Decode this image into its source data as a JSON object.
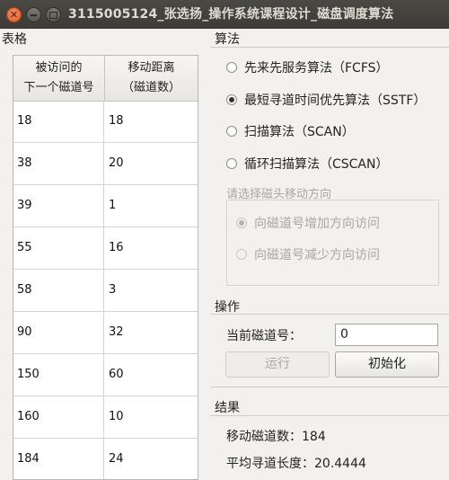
{
  "window": {
    "title": "3115005124_张选扬_操作系统课程设计_磁盘调度算法",
    "close_icon": "close-icon",
    "minimize_icon": "minimize-icon",
    "maximize_icon": "maximize-icon"
  },
  "table_group": {
    "label": "表格",
    "col1_line1": "被访问的",
    "col1_line2": "下一个磁道号",
    "col2_line1": "移动距离",
    "col2_line2": "（磁道数）",
    "rows": [
      [
        "18",
        "18"
      ],
      [
        "38",
        "20"
      ],
      [
        "39",
        "1"
      ],
      [
        "55",
        "16"
      ],
      [
        "58",
        "3"
      ],
      [
        "90",
        "32"
      ],
      [
        "150",
        "60"
      ],
      [
        "160",
        "10"
      ],
      [
        "184",
        "24"
      ]
    ]
  },
  "algorithm_group": {
    "label": "算法",
    "options": [
      {
        "label": "先来先服务算法（FCFS）",
        "checked": false
      },
      {
        "label": "最短寻道时间优先算法（SSTF）",
        "checked": true
      },
      {
        "label": "扫描算法（SCAN）",
        "checked": false
      },
      {
        "label": "循环扫描算法（CSCAN）",
        "checked": false
      }
    ],
    "direction_label": "请选择磁头移动方向",
    "direction_options": [
      {
        "label": "向磁道号增加方向访问",
        "checked": true
      },
      {
        "label": "向磁道号减少方向访问",
        "checked": false
      }
    ]
  },
  "operation_group": {
    "label": "操作",
    "current_track_label": "当前磁道号：",
    "current_track_value": "0",
    "run_button": "运行",
    "init_button": "初始化"
  },
  "result_group": {
    "label": "结果",
    "moved_tracks": "移动磁道数：184",
    "avg_seek": "平均寻道长度：20.4444"
  }
}
